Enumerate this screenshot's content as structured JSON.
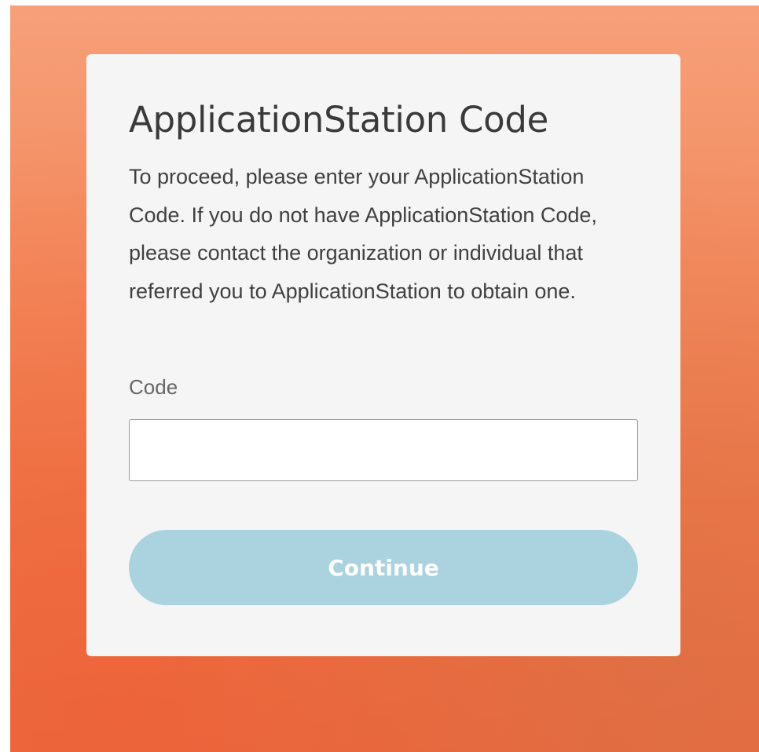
{
  "card": {
    "title": "ApplicationStation Code",
    "description": "To proceed, please enter your ApplicationStation Code. If you do not have ApplicationStation Code, please contact the organization or individual that referred you to ApplicationStation to obtain one."
  },
  "code_field": {
    "label": "Code",
    "value": "",
    "placeholder": ""
  },
  "continue_button": {
    "label": "Continue",
    "background": "#abd3df"
  },
  "colors": {
    "backdrop": "#f38b5e",
    "card": "#f5f5f5"
  }
}
